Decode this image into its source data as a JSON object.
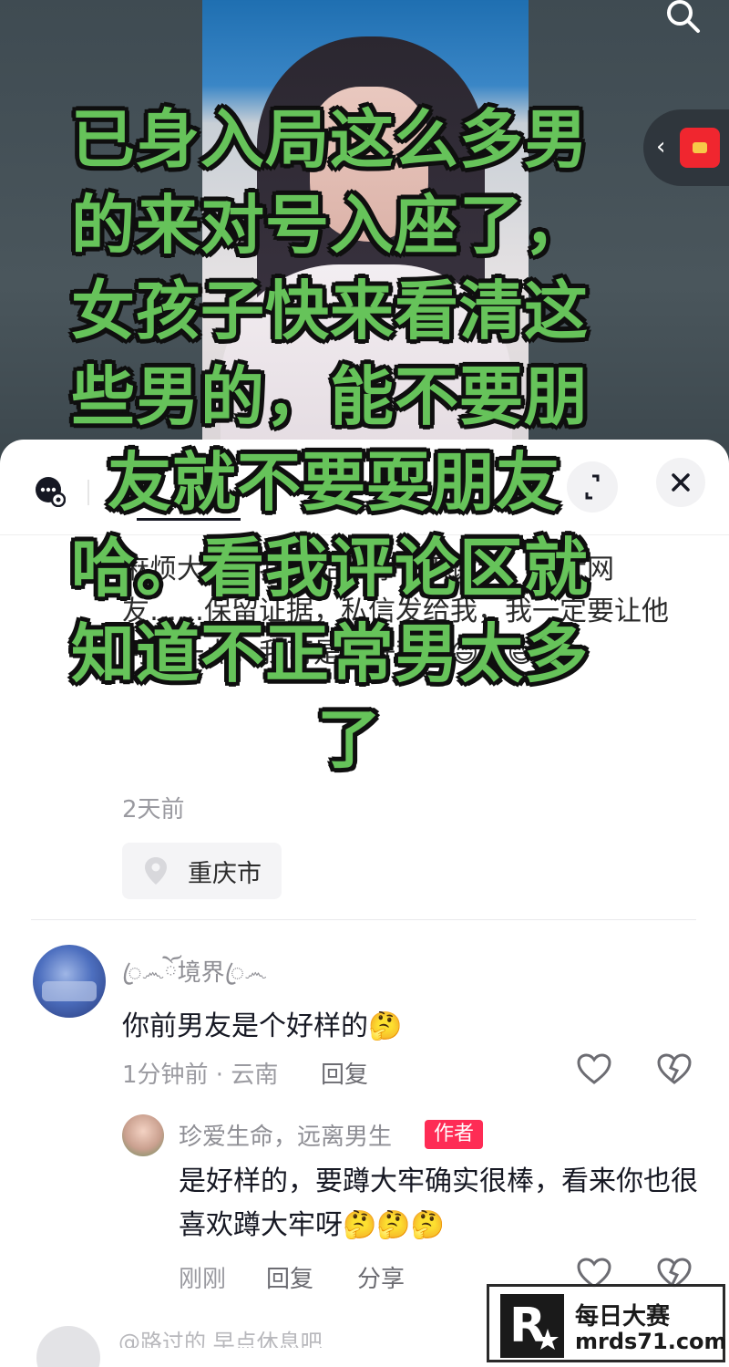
{
  "overlay": {
    "caption_lines": [
      "已身入局这么多男",
      "的来对号入座了，",
      "女孩子快来看清这",
      "些男的，能不要朋",
      "友就不要耍朋友",
      "哈。看我评论区就",
      "知道不正常男太多",
      "了"
    ]
  },
  "post": {
    "tab_label": "作品",
    "text": "麻烦大家给我作品推荐一下谢谢。广大网友……保留证据，私信发给我，我一定要让他判久一点。我可是不好惹的😄😄😄",
    "time": "2天前",
    "location": "重庆市"
  },
  "comments": [
    {
      "name": "ꦿ෴ོ境界ꦿ෴",
      "text": "你前男友是个好样的🤔",
      "meta": "1分钟前 · 云南",
      "reply_label": "回复",
      "reply": {
        "name": "珍爱生命，远离男生",
        "badge": "作者",
        "text": "是好样的，要蹲大牢确实很棒，看来你也很喜欢蹲大牢呀🤔🤔🤔",
        "time": "刚刚",
        "reply_label": "回复",
        "share_label": "分享"
      }
    }
  ],
  "third_comment_peek": "@路过的 早点休息吧",
  "watermark": {
    "logo_letter": "R",
    "title": "每日大赛",
    "url": "mrds71.com"
  },
  "colors": {
    "caption_fill": "#66c35a",
    "caption_stroke": "#0f0f0f",
    "author_badge": "#fe2c55",
    "red_packet": "#f0262f"
  },
  "icons": [
    "search-icon",
    "red-packet-icon",
    "chevron-left-icon",
    "comment-bubble-icon",
    "expand-icon",
    "close-icon",
    "location-pin-icon",
    "heart-icon",
    "broken-heart-icon"
  ]
}
